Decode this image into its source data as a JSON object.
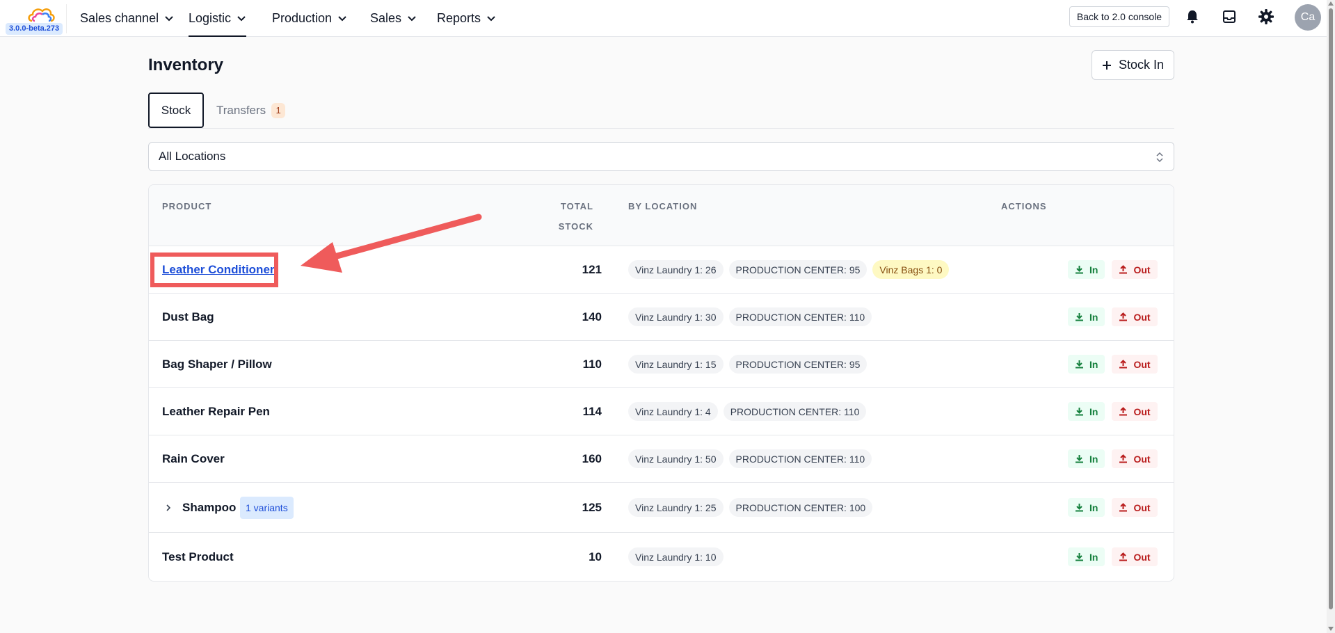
{
  "header": {
    "version": "3.0.0-beta.273",
    "nav": [
      {
        "label": "Sales channel",
        "active": false
      },
      {
        "label": "Logistic",
        "active": true
      },
      {
        "label": "Production",
        "active": false
      },
      {
        "label": "Sales",
        "active": false
      },
      {
        "label": "Reports",
        "active": false
      }
    ],
    "console_button": "Back to 2.0 console",
    "avatar_initials": "Ca",
    "icons": [
      "bell-icon",
      "inbox-icon",
      "gear-icon"
    ]
  },
  "page": {
    "title": "Inventory",
    "stock_in_label": "Stock In",
    "tabs": [
      {
        "label": "Stock",
        "active": true
      },
      {
        "label": "Transfers",
        "count": "1"
      }
    ],
    "location_filter": "All Locations"
  },
  "table": {
    "headers": {
      "product": "PRODUCT",
      "total_line1": "TOTAL",
      "total_line2": "STOCK",
      "by_location": "BY LOCATION",
      "actions": "ACTIONS"
    },
    "in_label": "In",
    "out_label": "Out",
    "rows": [
      {
        "product": "Leather Conditioner",
        "link": true,
        "total": "121",
        "locations": [
          "Vinz Laundry 1: 26",
          "PRODUCTION CENTER: 95",
          "Vinz Bags 1: 0"
        ]
      },
      {
        "product": "Dust Bag",
        "total": "140",
        "locations": [
          "Vinz Laundry 1: 30",
          "PRODUCTION CENTER: 110"
        ]
      },
      {
        "product": "Bag Shaper / Pillow",
        "total": "110",
        "locations": [
          "Vinz Laundry 1: 15",
          "PRODUCTION CENTER: 95"
        ]
      },
      {
        "product": "Leather Repair Pen",
        "total": "114",
        "locations": [
          "Vinz Laundry 1: 4",
          "PRODUCTION CENTER: 110"
        ]
      },
      {
        "product": "Rain Cover",
        "total": "160",
        "locations": [
          "Vinz Laundry 1: 50",
          "PRODUCTION CENTER: 110"
        ]
      },
      {
        "product": "Shampoo",
        "variants": "1 variants",
        "expandable": true,
        "total": "125",
        "locations": [
          "Vinz Laundry 1: 25",
          "PRODUCTION CENTER: 100"
        ]
      },
      {
        "product": "Test Product",
        "total": "10",
        "locations": [
          "Vinz Laundry 1: 10"
        ]
      }
    ]
  },
  "colors": {
    "accent_link": "#1d4ed8",
    "in_green": "#15803d",
    "out_red": "#b91c1c",
    "annotation_red": "#ef5b5b",
    "zero_stock_chip": "#fef9c3"
  }
}
